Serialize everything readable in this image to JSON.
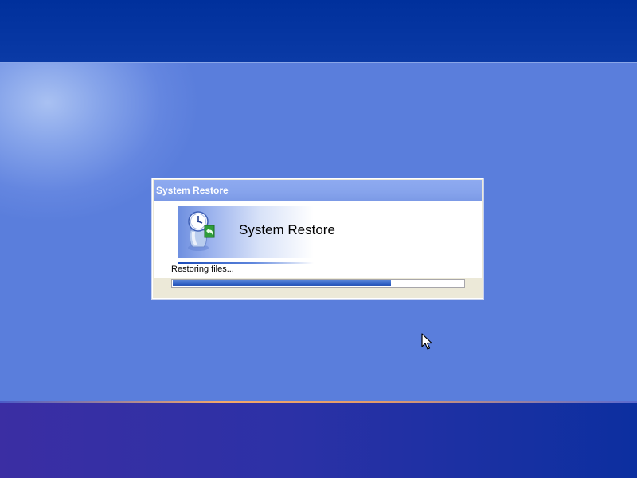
{
  "dialog": {
    "title": "System Restore",
    "banner_title": "System Restore",
    "status_text": "Restoring files...",
    "progress_percent": 75
  },
  "icons": {
    "banner_icon": "system-restore-icon",
    "pointer": "mouse-cursor-icon"
  },
  "colors": {
    "desktop_blue": "#5a7edc",
    "top_band": "#00309c",
    "titlebar": "#86a3ec",
    "dialog_face": "#ece9d8",
    "progress_fill": "#2f5fc4"
  }
}
